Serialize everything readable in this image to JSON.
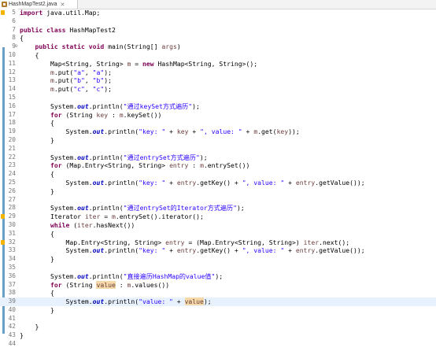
{
  "tab": {
    "title": "HashMapTest2.java",
    "close": "✕"
  },
  "lines": [
    {
      "n": "5",
      "t": [
        {
          "s": "import",
          "c": "kw"
        },
        {
          "s": " java.util.Map;"
        }
      ],
      "marker": true
    },
    {
      "n": "6",
      "t": []
    },
    {
      "n": "7",
      "t": [
        {
          "s": "public",
          "c": "kw"
        },
        {
          "s": " "
        },
        {
          "s": "class",
          "c": "kw"
        },
        {
          "s": " HashMapTest2"
        }
      ]
    },
    {
      "n": "8",
      "t": [
        {
          "s": "{"
        }
      ]
    },
    {
      "n": "9",
      "fold": "⊖",
      "t": [
        {
          "s": "    "
        },
        {
          "s": "public",
          "c": "kw"
        },
        {
          "s": " "
        },
        {
          "s": "static",
          "c": "kw"
        },
        {
          "s": " "
        },
        {
          "s": "void",
          "c": "kw"
        },
        {
          "s": " main(String[] "
        },
        {
          "s": "args",
          "c": "var"
        },
        {
          "s": ")"
        }
      ]
    },
    {
      "n": "10",
      "t": [
        {
          "s": "    {"
        }
      ]
    },
    {
      "n": "11",
      "t": [
        {
          "s": "        Map<String, String> "
        },
        {
          "s": "m",
          "c": "var"
        },
        {
          "s": " = "
        },
        {
          "s": "new",
          "c": "kw"
        },
        {
          "s": " HashMap<String, String>();"
        }
      ]
    },
    {
      "n": "12",
      "t": [
        {
          "s": "        "
        },
        {
          "s": "m",
          "c": "var"
        },
        {
          "s": ".put("
        },
        {
          "s": "\"a\"",
          "c": "str"
        },
        {
          "s": ", "
        },
        {
          "s": "\"a\"",
          "c": "str"
        },
        {
          "s": ");"
        }
      ]
    },
    {
      "n": "13",
      "t": [
        {
          "s": "        "
        },
        {
          "s": "m",
          "c": "var"
        },
        {
          "s": ".put("
        },
        {
          "s": "\"b\"",
          "c": "str"
        },
        {
          "s": ", "
        },
        {
          "s": "\"b\"",
          "c": "str"
        },
        {
          "s": ");"
        }
      ]
    },
    {
      "n": "14",
      "t": [
        {
          "s": "        "
        },
        {
          "s": "m",
          "c": "var"
        },
        {
          "s": ".put("
        },
        {
          "s": "\"c\"",
          "c": "str"
        },
        {
          "s": ", "
        },
        {
          "s": "\"c\"",
          "c": "str"
        },
        {
          "s": ");"
        }
      ]
    },
    {
      "n": "15",
      "t": []
    },
    {
      "n": "16",
      "t": [
        {
          "s": "        System."
        },
        {
          "s": "out",
          "c": "fld"
        },
        {
          "s": ".println("
        },
        {
          "s": "\"通过keySet方式遍历\"",
          "c": "str"
        },
        {
          "s": ");"
        }
      ]
    },
    {
      "n": "17",
      "t": [
        {
          "s": "        "
        },
        {
          "s": "for",
          "c": "kw"
        },
        {
          "s": " (String "
        },
        {
          "s": "key",
          "c": "var"
        },
        {
          "s": " : "
        },
        {
          "s": "m",
          "c": "var"
        },
        {
          "s": ".keySet())"
        }
      ]
    },
    {
      "n": "18",
      "t": [
        {
          "s": "        {"
        }
      ]
    },
    {
      "n": "19",
      "t": [
        {
          "s": "            System."
        },
        {
          "s": "out",
          "c": "fld"
        },
        {
          "s": ".println("
        },
        {
          "s": "\"key: \"",
          "c": "str"
        },
        {
          "s": " + "
        },
        {
          "s": "key",
          "c": "var"
        },
        {
          "s": " + "
        },
        {
          "s": "\", value: \"",
          "c": "str"
        },
        {
          "s": " + "
        },
        {
          "s": "m",
          "c": "var"
        },
        {
          "s": ".get("
        },
        {
          "s": "key",
          "c": "var"
        },
        {
          "s": "));"
        }
      ]
    },
    {
      "n": "20",
      "t": [
        {
          "s": "        }"
        }
      ]
    },
    {
      "n": "21",
      "t": []
    },
    {
      "n": "22",
      "t": [
        {
          "s": "        System."
        },
        {
          "s": "out",
          "c": "fld"
        },
        {
          "s": ".println("
        },
        {
          "s": "\"通过entrySet方式遍历\"",
          "c": "str"
        },
        {
          "s": ");"
        }
      ]
    },
    {
      "n": "23",
      "t": [
        {
          "s": "        "
        },
        {
          "s": "for",
          "c": "kw"
        },
        {
          "s": " (Map.Entry<String, String> "
        },
        {
          "s": "entry",
          "c": "var"
        },
        {
          "s": " : "
        },
        {
          "s": "m",
          "c": "var"
        },
        {
          "s": ".entrySet())"
        }
      ]
    },
    {
      "n": "24",
      "t": [
        {
          "s": "        {"
        }
      ]
    },
    {
      "n": "25",
      "t": [
        {
          "s": "            System."
        },
        {
          "s": "out",
          "c": "fld"
        },
        {
          "s": ".println("
        },
        {
          "s": "\"key: \"",
          "c": "str"
        },
        {
          "s": " + "
        },
        {
          "s": "entry",
          "c": "var"
        },
        {
          "s": ".getKey() + "
        },
        {
          "s": "\", value: \"",
          "c": "str"
        },
        {
          "s": " + "
        },
        {
          "s": "entry",
          "c": "var"
        },
        {
          "s": ".getValue());"
        }
      ]
    },
    {
      "n": "26",
      "t": [
        {
          "s": "        }"
        }
      ]
    },
    {
      "n": "27",
      "t": []
    },
    {
      "n": "28",
      "t": [
        {
          "s": "        System."
        },
        {
          "s": "out",
          "c": "fld"
        },
        {
          "s": ".println("
        },
        {
          "s": "\"通过entrySet的Iterator方式遍历\"",
          "c": "str"
        },
        {
          "s": ");"
        }
      ]
    },
    {
      "n": "29",
      "marker": true,
      "t": [
        {
          "s": "        Iterator "
        },
        {
          "s": "iter",
          "c": "var"
        },
        {
          "s": " = "
        },
        {
          "s": "m",
          "c": "var"
        },
        {
          "s": ".entrySet().iterator();"
        }
      ]
    },
    {
      "n": "30",
      "t": [
        {
          "s": "        "
        },
        {
          "s": "while",
          "c": "kw"
        },
        {
          "s": " ("
        },
        {
          "s": "iter",
          "c": "var"
        },
        {
          "s": ".hasNext())"
        }
      ]
    },
    {
      "n": "31",
      "t": [
        {
          "s": "        {"
        }
      ]
    },
    {
      "n": "32",
      "marker": true,
      "t": [
        {
          "s": "            Map.Entry<String, String> "
        },
        {
          "s": "entry",
          "c": "var"
        },
        {
          "s": " = (Map.Entry<String, String>) "
        },
        {
          "s": "iter",
          "c": "var"
        },
        {
          "s": ".next();"
        }
      ]
    },
    {
      "n": "33",
      "t": [
        {
          "s": "            System."
        },
        {
          "s": "out",
          "c": "fld"
        },
        {
          "s": ".println("
        },
        {
          "s": "\"key: \"",
          "c": "str"
        },
        {
          "s": " + "
        },
        {
          "s": "entry",
          "c": "var"
        },
        {
          "s": ".getKey() + "
        },
        {
          "s": "\", value: \"",
          "c": "str"
        },
        {
          "s": " + "
        },
        {
          "s": "entry",
          "c": "var"
        },
        {
          "s": ".getValue());"
        }
      ]
    },
    {
      "n": "34",
      "t": [
        {
          "s": "        }"
        }
      ]
    },
    {
      "n": "35",
      "t": []
    },
    {
      "n": "36",
      "t": [
        {
          "s": "        System."
        },
        {
          "s": "out",
          "c": "fld"
        },
        {
          "s": ".println("
        },
        {
          "s": "\"直接遍历HashMap的value值\"",
          "c": "str"
        },
        {
          "s": ");"
        }
      ]
    },
    {
      "n": "37",
      "t": [
        {
          "s": "        "
        },
        {
          "s": "for",
          "c": "kw"
        },
        {
          "s": " (String "
        },
        {
          "s": "value",
          "c": "occ"
        },
        {
          "s": " : "
        },
        {
          "s": "m",
          "c": "var"
        },
        {
          "s": ".values())"
        }
      ]
    },
    {
      "n": "38",
      "t": [
        {
          "s": "        {"
        }
      ]
    },
    {
      "n": "39",
      "current": true,
      "t": [
        {
          "s": "            System."
        },
        {
          "s": "out",
          "c": "fld"
        },
        {
          "s": ".println("
        },
        {
          "s": "\"value: \"",
          "c": "str"
        },
        {
          "s": " + "
        },
        {
          "s": "value",
          "c": "occ"
        },
        {
          "s": ");"
        }
      ]
    },
    {
      "n": "40",
      "t": [
        {
          "s": "        }"
        }
      ]
    },
    {
      "n": "41",
      "t": []
    },
    {
      "n": "42",
      "t": [
        {
          "s": "    }"
        }
      ]
    },
    {
      "n": "43",
      "t": [
        {
          "s": "}"
        }
      ]
    },
    {
      "n": "44",
      "t": []
    }
  ]
}
